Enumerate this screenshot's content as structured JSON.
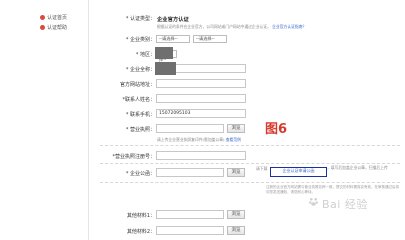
{
  "sidebar": {
    "items": [
      {
        "label": "认证首页"
      },
      {
        "label": "认证帮助"
      }
    ]
  },
  "form": {
    "type_label": "* 认证类型：",
    "type_value": "企业官方认证",
    "type_hint": "根据认证的条件在企业官方，公司网站或门户网站中通过企业认证。",
    "type_hint_link": "企业官方认证指南？",
    "industry_label": "* 企业类别：",
    "industry_select1": "--请选择--",
    "industry_select2": "--请选择--",
    "region_label": "* 地区：",
    "region_select": "--请选择--",
    "name_label": "* 企业全称：",
    "website_label": "官方网站地址：",
    "contact_label": "*联系人姓名：",
    "phone_label": "* 联系手机：",
    "phone_value": "15072095103",
    "license_label": "* 营业执照：",
    "license_btn": "浏览",
    "license_hint": "请上传企业营业执照复印件(需加盖公章)",
    "license_hint_link": "查看范例",
    "regno_label": "*营业执照注册号：",
    "letter_label": "* 企业公函：",
    "letter_btn": "浏览",
    "letter_hint_prefix": "请下载",
    "letter_hint_link": "企业认证申请公函",
    "letter_hint_suffix": "，填写后加盖企业公章，扫描后上传",
    "other1_label": "其他材料1：",
    "other1_btn": "浏览",
    "other2_label": "其他材料2：",
    "other2_btn": "浏览",
    "notes": "注册的企业官方网站需与营业执照名称一致，提交的材料需真实有效，在审核通过后将向您发送通知，请您耐心等待。"
  },
  "figure_label": "图6",
  "watermark": "Bai 经验",
  "colors": {
    "required": "#d8332d",
    "link": "#3366cc",
    "figure": "#d63a2f",
    "callout_border": "#1a2fa0"
  }
}
